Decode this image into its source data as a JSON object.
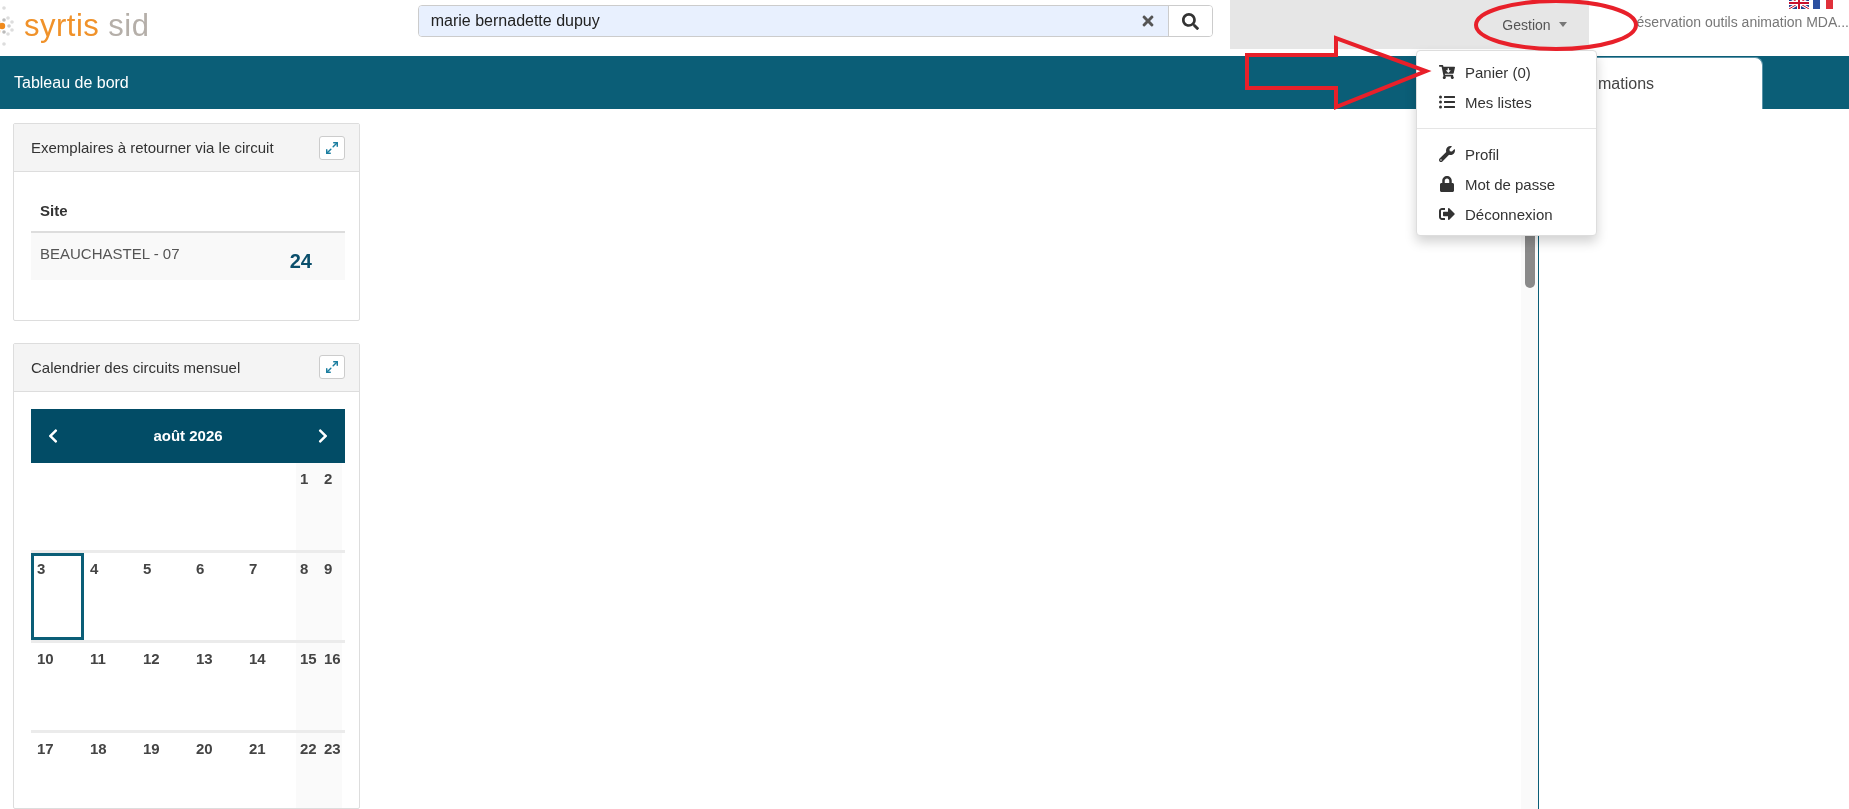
{
  "header": {
    "logo": {
      "name": "syrtis",
      "suffix": "sid"
    },
    "search": {
      "value": "marie bernadette dupuy"
    },
    "menu": {
      "label": "Gestion",
      "expanded": true
    },
    "reservation": "éservation outils animation MDA..."
  },
  "dropdown": [
    [
      {
        "label": "Panier (0)"
      },
      {
        "label": "Mes listes"
      }
    ],
    [
      {
        "label": "Profil"
      },
      {
        "label": "Mot de passe"
      },
      {
        "label": "Déconnexion"
      }
    ]
  ],
  "title_bar": {
    "title": "Tableau de bord",
    "tab": "mations"
  },
  "widgets": [
    {
      "kind": "table",
      "title": "Exemplaires à retourner via le circuit",
      "column": "Site",
      "rows": [
        {
          "site": "BEAUCHASTEL - 07",
          "count": "24"
        }
      ]
    },
    {
      "kind": "calendar",
      "title": "Calendrier des circuits mensuel",
      "month": "août 2026",
      "weeks": [
        [
          {
            "kind": "blank"
          },
          {
            "kind": "blank"
          },
          {
            "kind": "blank"
          },
          {
            "kind": "blank"
          },
          {
            "kind": "blank"
          },
          {
            "kind": "day",
            "day": "1",
            "selected": false
          },
          {
            "kind": "day",
            "day": "2",
            "selected": false
          }
        ],
        [
          {
            "kind": "day",
            "day": "3",
            "selected": true
          },
          {
            "kind": "day",
            "day": "4",
            "selected": false
          },
          {
            "kind": "day",
            "day": "5",
            "selected": false
          },
          {
            "kind": "day",
            "day": "6",
            "selected": false
          },
          {
            "kind": "day",
            "day": "7",
            "selected": false
          },
          {
            "kind": "day",
            "day": "8",
            "selected": false
          },
          {
            "kind": "day",
            "day": "9",
            "selected": false
          }
        ],
        [
          {
            "kind": "day",
            "day": "10",
            "selected": false
          },
          {
            "kind": "day",
            "day": "11",
            "selected": false
          },
          {
            "kind": "day",
            "day": "12",
            "selected": false
          },
          {
            "kind": "day",
            "day": "13",
            "selected": false
          },
          {
            "kind": "day",
            "day": "14",
            "selected": false
          },
          {
            "kind": "day",
            "day": "15",
            "selected": false
          },
          {
            "kind": "day",
            "day": "16",
            "selected": false
          }
        ],
        [
          {
            "kind": "day",
            "day": "17",
            "selected": false
          },
          {
            "kind": "day",
            "day": "18",
            "selected": false
          },
          {
            "kind": "day",
            "day": "19",
            "selected": false
          },
          {
            "kind": "day",
            "day": "20",
            "selected": false
          },
          {
            "kind": "day",
            "day": "21",
            "selected": false
          },
          {
            "kind": "day",
            "day": "22",
            "selected": false
          },
          {
            "kind": "day",
            "day": "23",
            "selected": false
          }
        ]
      ]
    }
  ]
}
